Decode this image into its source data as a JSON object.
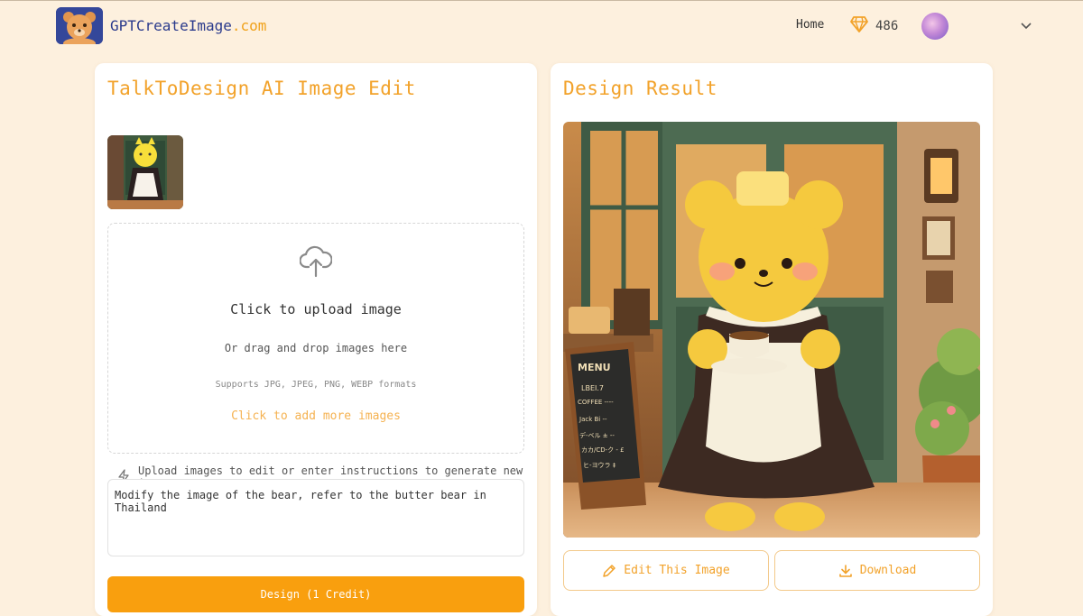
{
  "header": {
    "logo_text": "GPTCreateImage",
    "logo_domain": ".com",
    "nav_home": "Home",
    "credits": "486"
  },
  "left_panel": {
    "title": "TalkToDesign AI Image Edit",
    "upload_title": "Click to upload image",
    "upload_sub": "Or drag and drop images here",
    "upload_formats": "Supports JPG, JPEG, PNG, WEBP formats",
    "add_more": "Click to add more images",
    "hint": "Upload images to edit or enter instructions to generate new images",
    "prompt_value": "Modify the image of the bear, refer to the butter bear in Thailand",
    "design_button": "Design (1 Credit)"
  },
  "right_panel": {
    "title": "Design Result",
    "edit_button": "Edit This Image",
    "download_button": "Download",
    "menu_board": {
      "title": "MENU",
      "lines": [
        "LBEI.7",
        "COFFEE ----",
        "Jack Bi -- ",
        "デ-ベル ± --",
        "カカ/CD-ク - £",
        "ヒ-ヨウラ ‡"
      ]
    }
  },
  "icons": {
    "credits": "gem-icon",
    "upload": "cloud-upload-icon",
    "hint": "lightning-icon",
    "edit": "pencil-icon",
    "download": "download-icon",
    "dropdown": "chevron-down-icon"
  },
  "colors": {
    "background": "#fdf0de",
    "accent": "#f99f0e",
    "title": "#f2a22a",
    "logo_text": "#2a3a8c"
  }
}
